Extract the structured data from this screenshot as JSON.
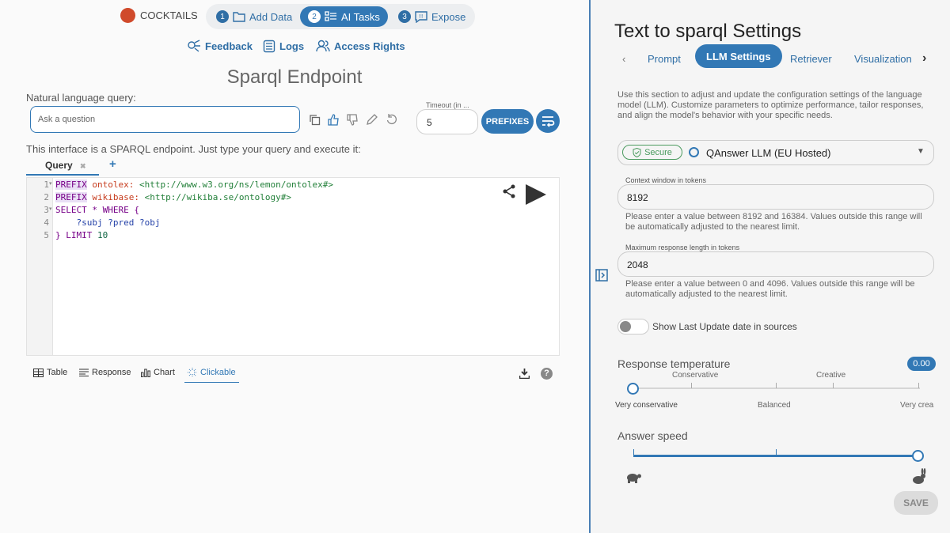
{
  "header": {
    "brand": "COCKTAILS",
    "steps": [
      {
        "num": "1",
        "label": "Add Data"
      },
      {
        "num": "2",
        "label": "AI Tasks"
      },
      {
        "num": "3",
        "label": "Expose"
      }
    ],
    "links": {
      "feedback": "Feedback",
      "logs": "Logs",
      "access": "Access Rights"
    }
  },
  "page_title": "Sparql Endpoint",
  "nl_query": {
    "label": "Natural language query:",
    "placeholder": "Ask a question"
  },
  "timeout": {
    "label": "Timeout (in ...",
    "value": "5"
  },
  "prefixes_button": "PREFIXES",
  "intro": "This interface is a SPARQL endpoint. Just type your query and execute it:",
  "query_tab": {
    "label": "Query",
    "close": "✖",
    "add": "+"
  },
  "editor": {
    "line_numbers": [
      "1",
      "2",
      "3",
      "4",
      "5"
    ],
    "l1": {
      "kw": "PREFIX",
      "pfx": " ontolex:",
      "uri": " <http://www.w3.org/ns/lemon/ontolex#>"
    },
    "l2": {
      "kw": "PREFIX",
      "pfx": " wikibase:",
      "uri": " <http://wikiba.se/ontology#>"
    },
    "l3": {
      "text": "SELECT * WHERE {"
    },
    "l4": {
      "text": "    ?subj ?pred ?obj"
    },
    "l5": {
      "brace": "} LIMIT ",
      "num": "10"
    }
  },
  "result_tabs": [
    "Table",
    "Response",
    "Chart",
    "Clickable"
  ],
  "settings": {
    "title": "Text to sparql Settings",
    "tabs": [
      "Prompt",
      "LLM Settings",
      "Retriever",
      "Visualization"
    ],
    "description": "Use this section to adjust and update the configuration settings of the language model (LLM). Customize parameters to optimize performance, tailor responses, and align the model's behavior with your specific needs.",
    "model": {
      "badge": "Secure",
      "name": "QAnswer LLM (EU Hosted)"
    },
    "context": {
      "label": "Context window in tokens",
      "value": "8192",
      "help": "Please enter a value between 8192 and 16384. Values outside this range will be automatically adjusted to the nearest limit."
    },
    "maxlen": {
      "label": "Maximum response length in tokens",
      "value": "2048",
      "help": "Please enter a value between 0 and 4096. Values outside this range will be automatically adjusted to the nearest limit."
    },
    "show_last_update": {
      "label": "Show Last Update date in sources",
      "on": false
    },
    "temperature": {
      "label": "Response temperature",
      "value": "0.00",
      "top_marks": [
        "Conservative",
        "Creative"
      ],
      "bottom_marks": [
        "Very conservative",
        "Balanced",
        "Very crea"
      ]
    },
    "speed": {
      "label": "Answer speed",
      "level": 1.0
    },
    "save": "SAVE"
  },
  "colors": {
    "accent": "#3278b5",
    "brand": "#d04a2b",
    "secure": "#4a9a5e"
  }
}
